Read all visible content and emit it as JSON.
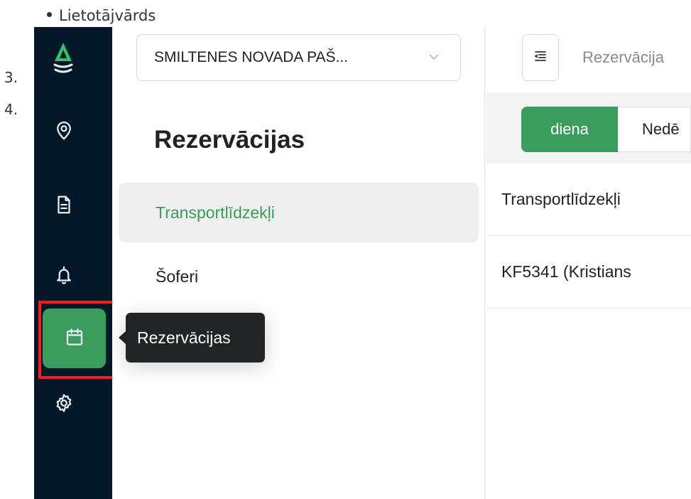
{
  "doc": {
    "bullet_text": "Lietotājvārds",
    "num3": "3.",
    "num4": "4."
  },
  "rail": {
    "items": [
      {
        "icon": "location-pin-icon"
      },
      {
        "icon": "document-icon"
      },
      {
        "icon": "bell-icon"
      },
      {
        "icon": "calendar-icon",
        "active": true
      },
      {
        "icon": "gear-icon"
      }
    ],
    "active_color": "#3a9d5d",
    "background": "#04182a"
  },
  "tooltip": {
    "text": "Rezervācijas"
  },
  "subpanel": {
    "org_select_value": "SMILTENES NOVADA PAŠ...",
    "title": "Rezervācijas",
    "menu": [
      {
        "label": "Transportlīdzekļi",
        "active": true
      },
      {
        "label": "Šoferi",
        "active": false
      }
    ]
  },
  "main": {
    "breadcrumb": "Rezervācija",
    "view_tabs": [
      {
        "label": "diena",
        "active": true
      },
      {
        "label": "Nedē",
        "active": false
      }
    ],
    "rows": [
      {
        "text": "Transportlīdzekļi"
      },
      {
        "text": "KF5341 (Kristians"
      }
    ]
  }
}
